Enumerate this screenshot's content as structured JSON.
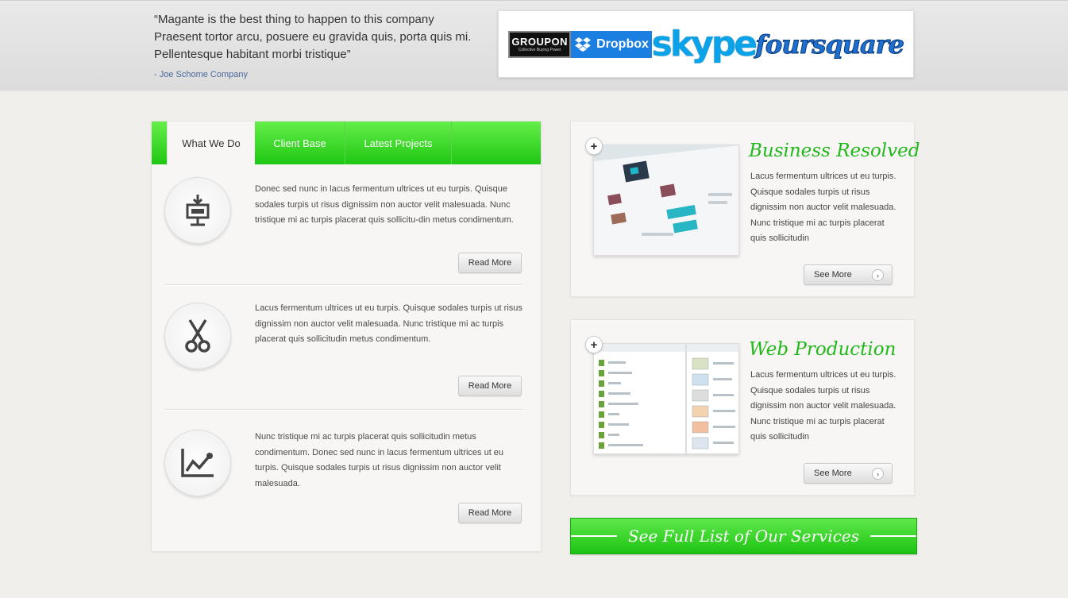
{
  "testimonial": {
    "quote": "“Magante is the best thing to happen to this company Praesent tortor arcu, posuere eu gravida quis, porta quis mi. Pellentesque habitant morbi tristique”",
    "author": "- Joe Schome Company"
  },
  "logos": {
    "groupon": "GROUPON",
    "groupon_tag": "Collective Buying Power",
    "dropbox": "Dropbox",
    "skype": "skype",
    "foursquare": "foursquare"
  },
  "tabs": [
    {
      "label": "What We Do"
    },
    {
      "label": "Client Base"
    },
    {
      "label": "Latest Projects"
    }
  ],
  "features": [
    {
      "icon": "presentation-board-icon",
      "text": "Donec sed nunc in lacus fermentum ultrices ut eu turpis. Quisque sodales turpis ut risus dignissim non auctor velit malesuada. Nunc tristique mi ac turpis placerat quis sollicitu-din metus condimentum.",
      "button": "Read More"
    },
    {
      "icon": "scissors-icon",
      "text": "Lacus fermentum ultrices ut eu turpis. Quisque sodales turpis ut risus dignissim non auctor velit malesuada. Nunc tristique mi ac turpis placerat quis sollicitudin metus condimentum.",
      "button": "Read More"
    },
    {
      "icon": "line-chart-icon",
      "text": "Nunc tristique mi ac turpis placerat quis sollicitudin metus condimentum. Donec sed nunc in lacus fermentum ultrices ut eu turpis. Quisque sodales turpis ut risus dignissim non auctor velit malesuada.",
      "button": "Read More"
    }
  ],
  "services": [
    {
      "title": "Business Resolved",
      "text": "Lacus fermentum ultrices ut eu turpis. Quisque sodales turpis ut risus dignissim non auctor velit malesuada. Nunc tristique mi ac turpis placerat quis sollicitudin",
      "button": "See More",
      "plus": "+",
      "arrow": "›"
    },
    {
      "title": "Web Production",
      "text": "Lacus fermentum ultrices ut eu turpis. Quisque sodales turpis ut risus dignissim non auctor velit malesuada. Nunc tristique mi ac turpis placerat quis sollicitudin",
      "button": "See More",
      "plus": "+",
      "arrow": "›"
    }
  ],
  "full_list_button": "See Full List  of  Our Services",
  "colors": {
    "accent": "#22c215",
    "accent_light": "#65ee4a",
    "background": "#f1efec",
    "link": "#4a6a9a"
  }
}
